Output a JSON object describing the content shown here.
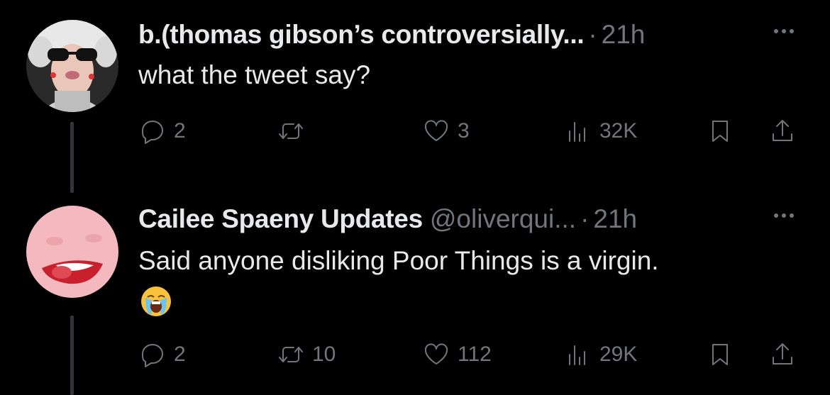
{
  "tweets": [
    {
      "name": "b.(thomas gibson’s controversially...",
      "handle": "",
      "time": "21h",
      "text": "what the tweet say?",
      "emoji": "",
      "replies": "2",
      "retweets": "",
      "likes": "3",
      "views": "32K"
    },
    {
      "name": "Cailee Spaeny Updates",
      "handle": "@oliverqui...",
      "time": "21h",
      "text": "Said anyone disliking Poor Things is a virgin.",
      "emoji": "loudly-crying-face",
      "replies": "2",
      "retweets": "10",
      "likes": "112",
      "views": "29K"
    }
  ],
  "separator": "·",
  "colors": {
    "background": "#000000",
    "primary_text": "#e7e9ea",
    "secondary_text": "#71767b",
    "thread_line": "#333639"
  }
}
